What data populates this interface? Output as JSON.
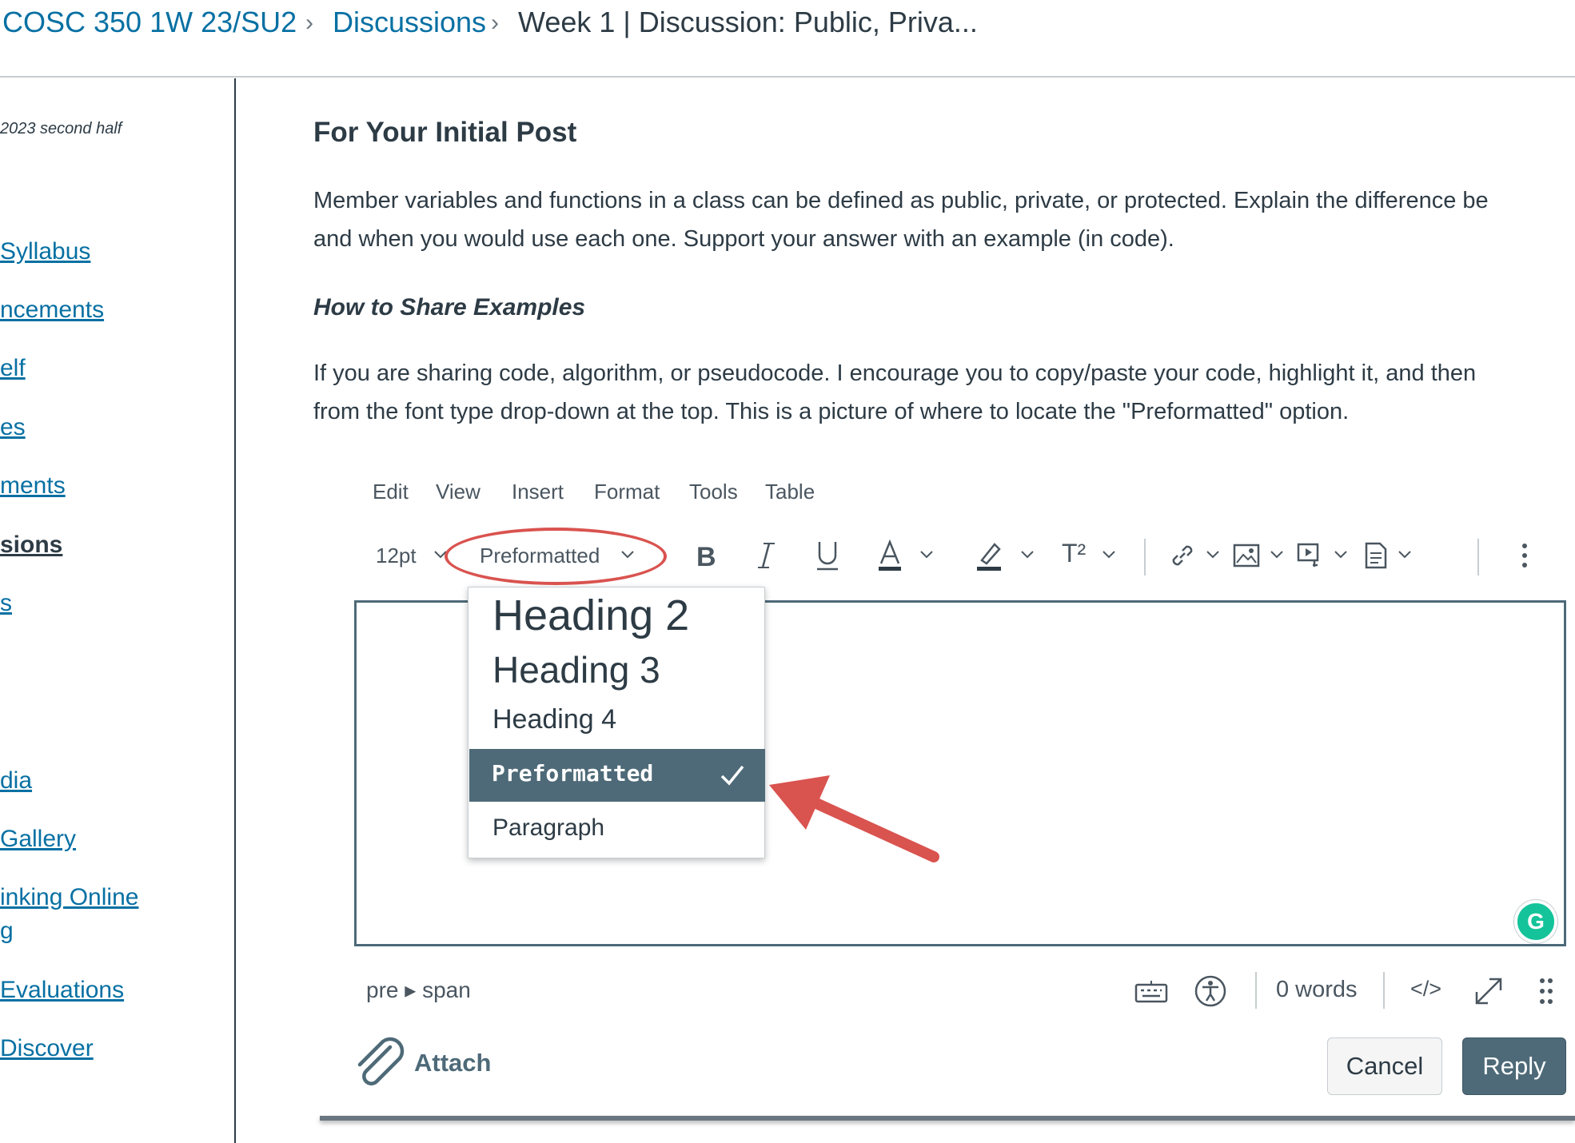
{
  "breadcrumb": {
    "course": "COSC 350 1W 23/SU2",
    "section": "Discussions",
    "current": "Week 1 | Discussion: Public, Priva..."
  },
  "sidebar": {
    "term": "2023 second half",
    "items": [
      {
        "label": "Syllabus",
        "active": false
      },
      {
        "label": "ncements",
        "active": false
      },
      {
        "label": "elf",
        "active": false
      },
      {
        "label": "es",
        "active": false
      },
      {
        "label": "ments",
        "active": false
      },
      {
        "label": "sions",
        "active": true
      },
      {
        "label": "s",
        "active": false
      },
      {
        "label": "dia",
        "active": false
      },
      {
        "label": "Gallery",
        "active": false
      },
      {
        "label": "inking Online",
        "active": false
      },
      {
        "label": "g",
        "active": false
      },
      {
        "label": " Evaluations",
        "active": false
      },
      {
        "label": "Discover",
        "active": false
      }
    ]
  },
  "content": {
    "heading": "For Your Initial Post",
    "para1_line1": "Member variables and functions in a class can be defined as public, private, or protected. Explain the difference be",
    "para1_line2": "and when you would use each one. Support your answer with an example (in code).",
    "subheading": "How to Share Examples",
    "para2_line1": "If you are sharing code, algorithm, or pseudocode. I encourage you to copy/paste your code, highlight it, and then",
    "para2_line2": "from the font type drop-down at the top. This is a picture of where to locate the \"Preformatted\" option."
  },
  "editor": {
    "menu": [
      "Edit",
      "View",
      "Insert",
      "Format",
      "Tools",
      "Table"
    ],
    "font_size": "12pt",
    "block_format": "Preformatted",
    "dropdown": {
      "heading2": "Heading 2",
      "heading3": "Heading 3",
      "heading4": "Heading 4",
      "selected": "Preformatted",
      "paragraph": "Paragraph"
    },
    "path": "pre ▸ span",
    "word_count": "0 words",
    "html_toggle": "</>",
    "attach": "Attach",
    "cancel": "Cancel",
    "reply": "Reply",
    "superscript": "T²",
    "grammarly": "G"
  },
  "colors": {
    "link": "#0770a3",
    "text": "#2d3b45",
    "button_primary": "#4e6a78",
    "annotation": "#d9534f"
  }
}
